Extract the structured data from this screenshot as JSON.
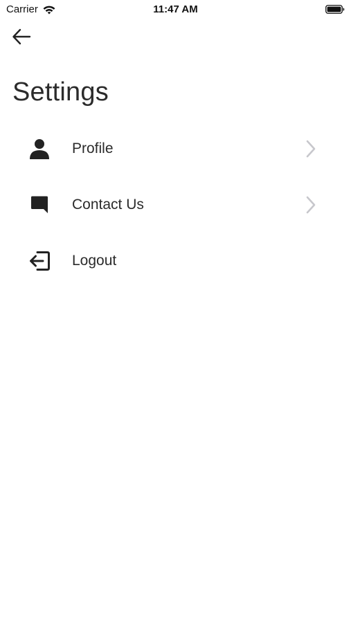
{
  "status_bar": {
    "carrier": "Carrier",
    "time": "11:47 AM"
  },
  "header": {
    "back_icon": "arrow-left-icon",
    "title": "Settings"
  },
  "menu": {
    "items": [
      {
        "label": "Profile",
        "icon": "person-icon",
        "has_chevron": true
      },
      {
        "label": "Contact Us",
        "icon": "chat-bubble-icon",
        "has_chevron": true
      },
      {
        "label": "Logout",
        "icon": "logout-icon",
        "has_chevron": false
      }
    ]
  },
  "colors": {
    "background": "#ffffff",
    "text": "#2b2b2b",
    "icon": "#222222",
    "chevron": "#c7c7cc"
  }
}
